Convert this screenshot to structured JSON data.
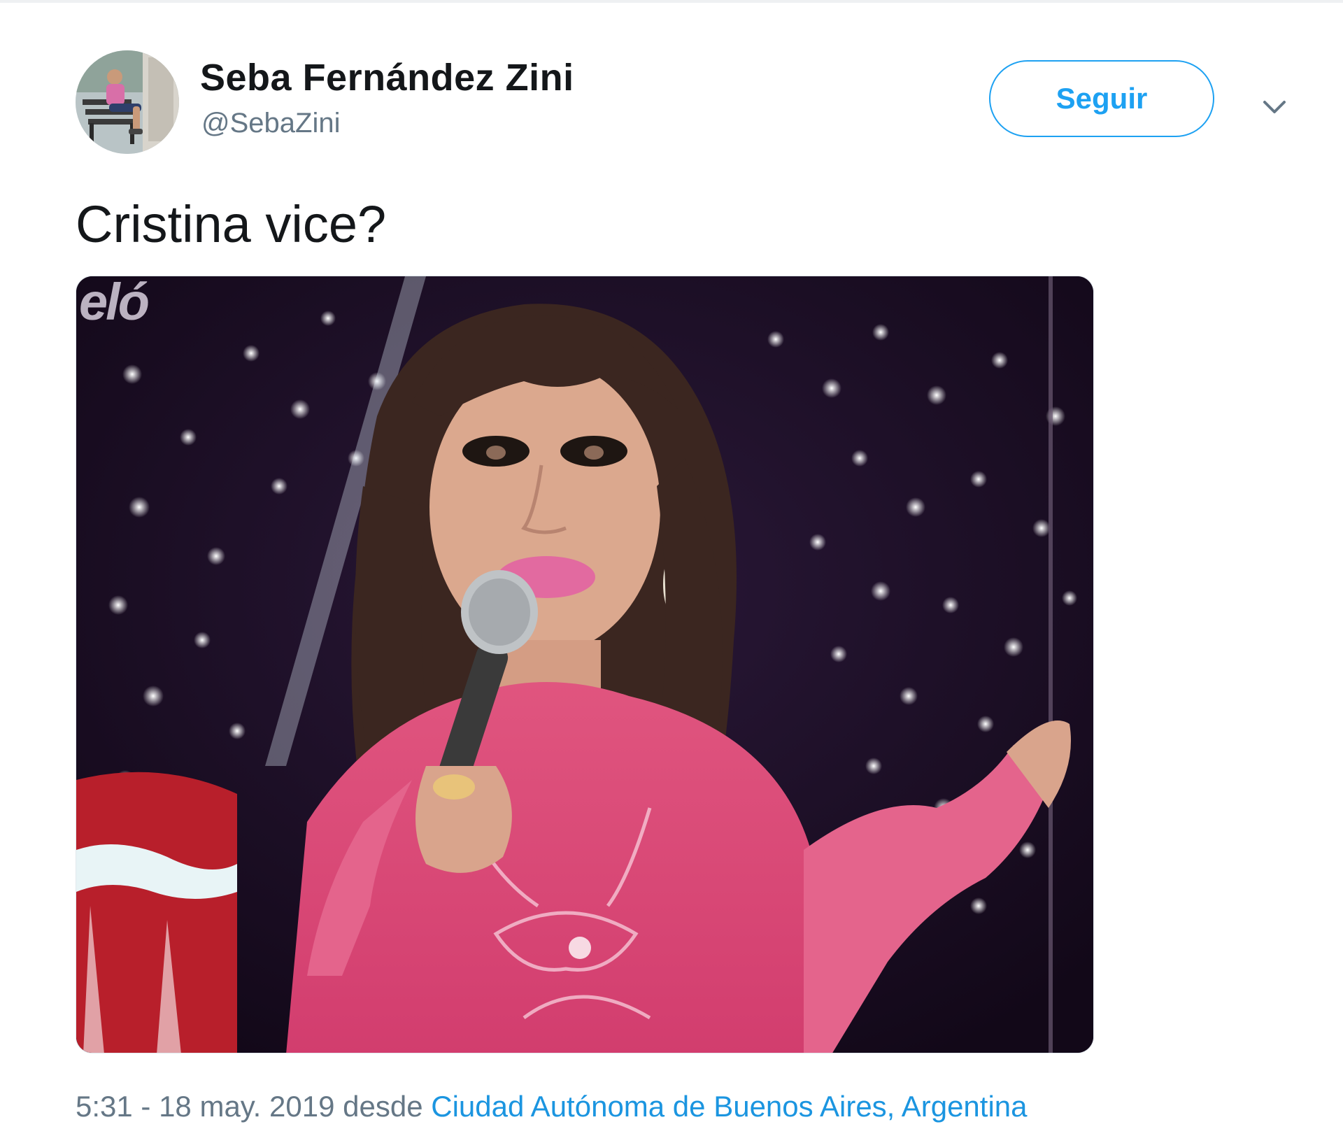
{
  "author": {
    "display_name": "Seba Fernández Zini",
    "handle": "@SebaZini"
  },
  "actions": {
    "follow_label": "Seguir",
    "more_icon": "chevron-down-icon"
  },
  "tweet": {
    "text": "Cristina vice?",
    "media": {
      "watermark": "eló"
    }
  },
  "meta": {
    "timestamp": "5:31 - 18 may. 2019",
    "from_label": "desde",
    "location": "Ciudad Autónoma de Buenos Aires, Argentina"
  },
  "colors": {
    "accent": "#1da1f2",
    "link": "#1b95e0",
    "text": "#14171a",
    "secondary_text": "#657786"
  }
}
